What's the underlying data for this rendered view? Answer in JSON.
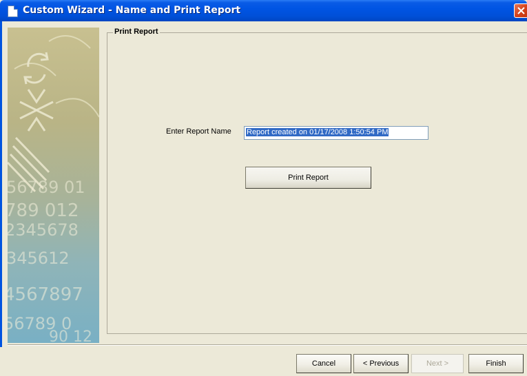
{
  "window": {
    "title": "Custom Wizard - Name and Print Report",
    "close_icon": "close-icon",
    "app_icon": "document-icon"
  },
  "side_panel": {
    "decoration_icons": [
      "refresh-icon",
      "asterisk-icon",
      "stripes-icon"
    ],
    "background_digits": [
      "56789 01",
      "789 012",
      "2345678",
      "345612",
      "4567897",
      "56789 0",
      "90 12"
    ]
  },
  "group": {
    "label": "Print Report"
  },
  "form": {
    "report_name_label": "Enter Report Name",
    "report_name_value": "Report created on 01/17/2008 1:50:54 PM",
    "print_button_label": "Print Report"
  },
  "footer": {
    "cancel_label": "Cancel",
    "previous_label": "< Previous",
    "next_label": "Next >",
    "finish_label": "Finish"
  },
  "colors": {
    "titlebar": "#0054e3",
    "dialog_bg": "#ece9d8",
    "selection": "#316ac5",
    "close_button": "#d6431d"
  }
}
